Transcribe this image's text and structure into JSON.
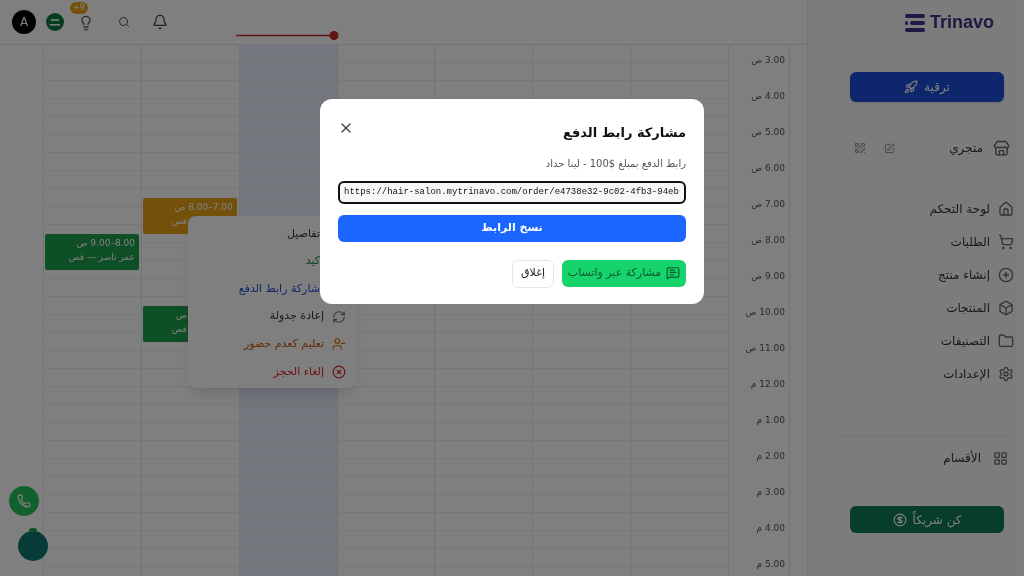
{
  "topbar": {
    "avatar": "A",
    "notification_badge": "+9"
  },
  "logo": {
    "name": "Trinavo"
  },
  "sidebar": {
    "upgrade_button": "ترقية",
    "store": "متجري",
    "nav": [
      "لوحة التحكم",
      "الطلبات",
      "إنشاء منتج",
      "المنتجات",
      "التصنيفات",
      "الإعدادات"
    ],
    "sections": "الأقسام",
    "partner_button": "كن شريكاً"
  },
  "calendar": {
    "time_labels": [
      "3.00 ص",
      "4.00 ص",
      "5.00 ص",
      "6.00 ص",
      "7.00 ص",
      "8.00 ص",
      "9.00 ص",
      "10.00 ص",
      "11.00 ص",
      "12.00 م",
      "1.00 م",
      "2.00 م",
      "3.00 م",
      "4.00 م",
      "5.00 م"
    ],
    "events": [
      {
        "time": "7.00–8.00 ص",
        "title": "قص",
        "kind": "pending",
        "time_covered": false,
        "title_covered": true
      },
      {
        "time": "8.00–9.00 ص",
        "title": "عمر ناصر — قص",
        "kind": "confirmed",
        "time_covered": false,
        "title_covered": false
      },
      {
        "time": "ص",
        "title": "قص",
        "kind": "confirmed",
        "time_covered": true,
        "title_covered": true
      }
    ]
  },
  "context_menu": {
    "items": [
      {
        "label": "تفاصيل",
        "kind": "default",
        "covered": true
      },
      {
        "label": "كيد",
        "kind": "success",
        "covered": true
      },
      {
        "label": "شاركة رابط الدفع",
        "kind": "primary",
        "covered": true
      },
      {
        "label": "إعادة جدولة",
        "kind": "default",
        "covered": false
      },
      {
        "label": "تعليم كعدم حضور",
        "kind": "warning",
        "covered": false
      },
      {
        "label": "إلغاء الحجز",
        "kind": "danger",
        "covered": false
      }
    ]
  },
  "dialog": {
    "title": "مشاركة رابط الدفع",
    "subtitle": "رابط الدفع بمبلغ $100 - لينا حداد",
    "url": "https://hair-salon.mytrinavo.com/order/e4738e32-9c02-4fb3-94eb",
    "copy_button": "نسخ الرابط",
    "whatsapp_button": "مشاركة عبر واتساب",
    "close_button": "إغلاق"
  }
}
